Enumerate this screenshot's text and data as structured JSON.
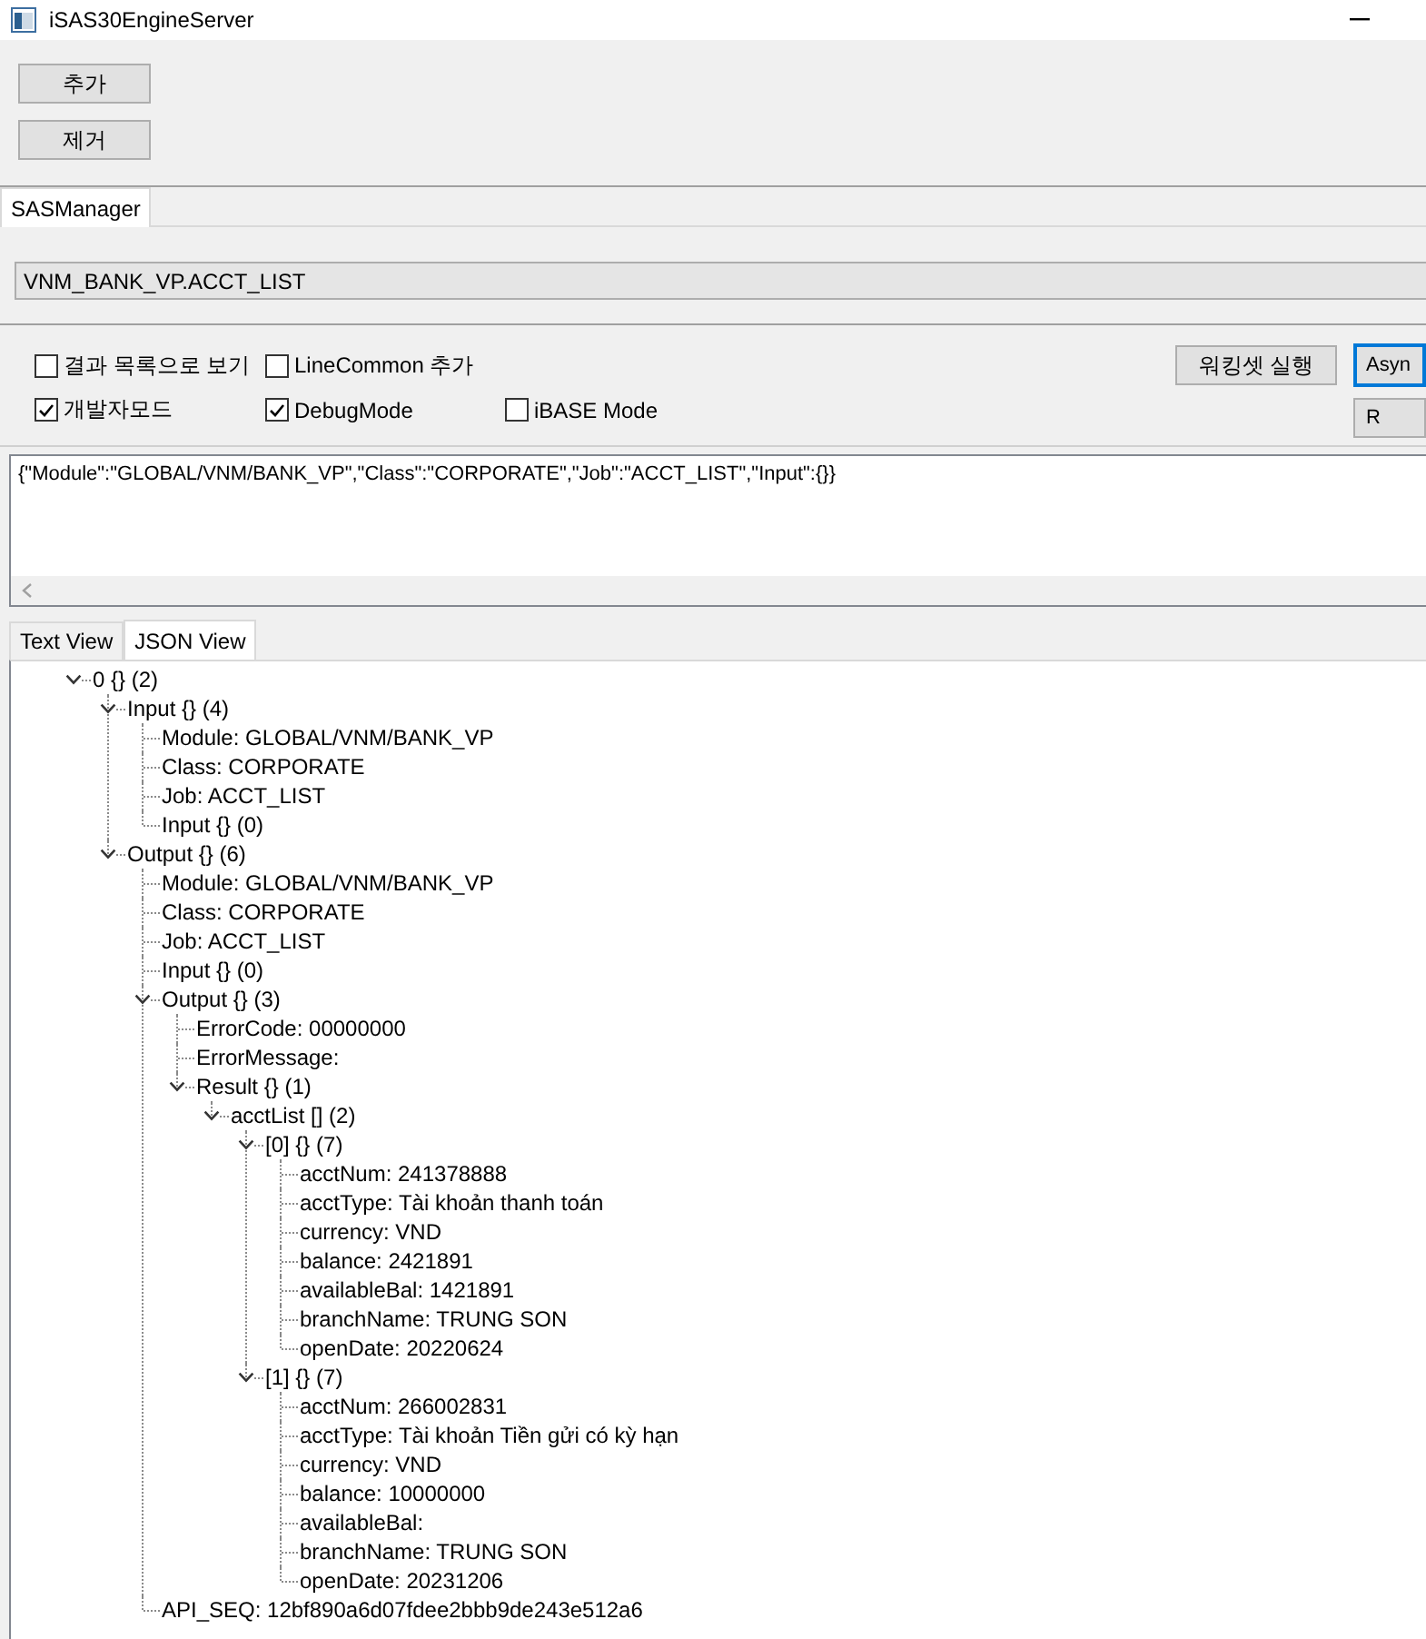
{
  "window": {
    "title": "iSAS30EngineServer"
  },
  "toolbar": {
    "buttons": [
      "추가",
      "제거"
    ]
  },
  "main_tabs": [
    {
      "label": "SASManager",
      "selected": true
    }
  ],
  "service_field": {
    "value": "VNM_BANK_VP.ACCT_LIST"
  },
  "options": [
    {
      "label": "결과 목록으로 보기",
      "checked": false
    },
    {
      "label": "LineCommon 추가",
      "checked": false
    },
    {
      "label": "개발자모드",
      "checked": true
    },
    {
      "label": "DebugMode",
      "checked": true
    },
    {
      "label": "iBASE Mode",
      "checked": false
    }
  ],
  "action_buttons": [
    {
      "label": "워킹셋 실행",
      "default": false
    },
    {
      "label": "Asyn",
      "default": true
    },
    {
      "label": "R",
      "default": false
    }
  ],
  "request_editor": {
    "value": "{\"Module\":\"GLOBAL/VNM/BANK_VP\",\"Class\":\"CORPORATE\",\"Job\":\"ACCT_LIST\",\"Input\":{}}"
  },
  "view_tabs": [
    {
      "label": "Text View",
      "selected": false
    },
    {
      "label": "JSON View",
      "selected": true
    }
  ],
  "tree": [
    {
      "label": "0 {} (2)",
      "expanded": true,
      "children": [
        {
          "label": "Input {} (4)",
          "expanded": true,
          "children": [
            {
              "label": "Module: GLOBAL/VNM/BANK_VP"
            },
            {
              "label": "Class: CORPORATE"
            },
            {
              "label": "Job: ACCT_LIST"
            },
            {
              "label": "Input {} (0)"
            }
          ]
        },
        {
          "label": "Output {} (6)",
          "expanded": true,
          "children": [
            {
              "label": "Module: GLOBAL/VNM/BANK_VP"
            },
            {
              "label": "Class: CORPORATE"
            },
            {
              "label": "Job: ACCT_LIST"
            },
            {
              "label": "Input {} (0)"
            },
            {
              "label": "Output {} (3)",
              "expanded": true,
              "children": [
                {
                  "label": "ErrorCode: 00000000"
                },
                {
                  "label": "ErrorMessage:"
                },
                {
                  "label": "Result {} (1)",
                  "expanded": true,
                  "children": [
                    {
                      "label": "acctList [] (2)",
                      "expanded": true,
                      "children": [
                        {
                          "label": "[0] {} (7)",
                          "expanded": true,
                          "children": [
                            {
                              "label": "acctNum: 241378888"
                            },
                            {
                              "label": "acctType: Tài khoản thanh toán"
                            },
                            {
                              "label": "currency: VND"
                            },
                            {
                              "label": "balance: 2421891"
                            },
                            {
                              "label": "availableBal: 1421891"
                            },
                            {
                              "label": "branchName: TRUNG SON"
                            },
                            {
                              "label": "openDate: 20220624"
                            }
                          ]
                        },
                        {
                          "label": "[1] {} (7)",
                          "expanded": true,
                          "children": [
                            {
                              "label": "acctNum: 266002831"
                            },
                            {
                              "label": "acctType: Tài khoản Tiền gửi có kỳ hạn"
                            },
                            {
                              "label": "currency: VND"
                            },
                            {
                              "label": "balance: 10000000"
                            },
                            {
                              "label": "availableBal:"
                            },
                            {
                              "label": "branchName: TRUNG SON"
                            },
                            {
                              "label": "openDate: 20231206"
                            }
                          ]
                        }
                      ]
                    }
                  ]
                }
              ]
            },
            {
              "label": "API_SEQ: 12bf890a6d07fdee2bbb9de243e512a6"
            }
          ]
        }
      ]
    }
  ]
}
